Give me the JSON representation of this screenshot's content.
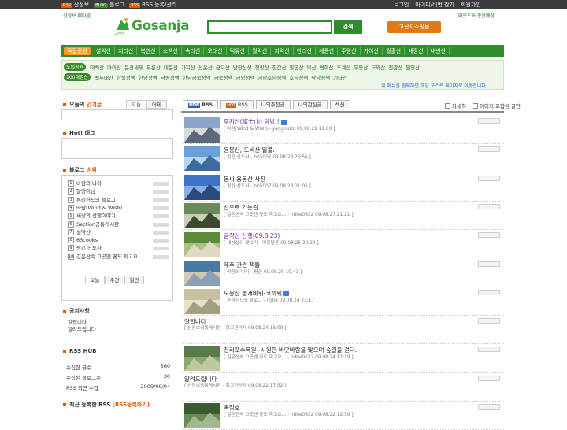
{
  "topbar": {
    "left": [
      {
        "tag": "RSS",
        "label": "산정보"
      },
      {
        "tag": "BLOG",
        "label": "블로그"
      },
      {
        "tag": "RSS",
        "label": "RSS 등록/관리"
      }
    ],
    "right": [
      "로그인",
      "아이디/비번 찾기",
      "회원가입"
    ]
  },
  "subtitle_left": "산정보 메타블",
  "subtitle_right": "마웃도어 종합매장",
  "logo": {
    "text": "Gosanja",
    "korean": "고산자"
  },
  "search": {
    "value": "",
    "button": "검색"
  },
  "shop_button": "고산자쇼핑몰",
  "nav1": {
    "first": "국립공원",
    "items": [
      "설악산",
      "지리산",
      "북한산",
      "소백산",
      "속리산",
      "오대산",
      "덕유산",
      "월악산",
      "치악산",
      "한라산",
      "계룡산",
      "주왕산",
      "가야산",
      "월출산",
      "내장산",
      "내변산"
    ]
  },
  "nav2": {
    "row1_label": "도립공원",
    "row1": [
      "태백산",
      "마이산",
      "문경새재",
      "두륜산",
      "대둔산",
      "가지산",
      "선운산",
      "금오산",
      "남한산성",
      "청량산",
      "칠갑산",
      "팔공산",
      "덕산",
      "연화산",
      "조계산",
      "무등산",
      "모악산",
      "천관산",
      "팔영산"
    ],
    "row2_label": "100대명산",
    "row2": [
      "백두대간",
      "한북정맥",
      "한남정맥",
      "낙동정맥",
      "한남금북정맥",
      "금북정맥",
      "금남정맥",
      "금남호남정맥",
      "호남정맥",
      "낙남정맥",
      "기타산"
    ],
    "note": "위 메뉴를 클릭하면 해당 포스트 페이지로 이동합니다."
  },
  "left": {
    "today": {
      "title_prefix": "오늘의",
      "title_accent": "인기글",
      "tabs": [
        "오늘",
        "어제"
      ]
    },
    "hot": {
      "title": "Hot! 태그"
    },
    "blog": {
      "title_prefix": "블로그",
      "title_accent": "순위",
      "items": [
        "바람의 나라",
        "말방이님",
        "론리헌드의 블로그",
        "바람(Wind & Wish)",
        "세상의 산행이야기",
        "Section공통게시판",
        "설악산",
        "63cooks",
        "링컨 산도사",
        "길은산속 그곳엔 꽃도 피고요..."
      ],
      "tabs": [
        "오늘",
        "주간",
        "월간"
      ]
    },
    "notice": {
      "title": "공지사항",
      "items": [
        "알립니다",
        "알려드립니다"
      ]
    },
    "rsshub": {
      "title": "RSS HUB",
      "rows": [
        {
          "label": "수집한 글수",
          "value": "360"
        },
        {
          "label": "수집된 블로그수",
          "value": "30"
        },
        {
          "label": "RSS 최근 수집",
          "value": "2009/09/04"
        }
      ]
    },
    "recent": {
      "title_prefix": "최근 등록한 RSS",
      "title_accent": "[RSS등록하기]"
    }
  },
  "main": {
    "tabs": [
      {
        "mark": "NEW",
        "label": "RSS"
      },
      {
        "mark": "HOT",
        "label": "RSS"
      },
      {
        "mark": "",
        "label": "나의추천글"
      },
      {
        "mark": "",
        "label": "나의관심글"
      },
      {
        "mark": "",
        "label": "섹션"
      }
    ],
    "options": [
      "자세히",
      "이미지 포함된 글만"
    ],
    "posts": [
      {
        "title": "후지산(富士山) 탐방 !",
        "meta": "[ 바람(Wind & Wish) - yangmoto   09.08.29 11:00 ]",
        "style": "purple",
        "thumb": true,
        "v": true
      },
      {
        "title": "용봉산, 도비산 일몰.",
        "meta": "[ 링컨 산도사 - hh5007   09.08.28 23:56 ]",
        "style": "normal",
        "thumb": true,
        "v": false
      },
      {
        "title": "동씨 용봉산 사진",
        "meta": "[ 링컨 산도사 - hh5007   09.08.28 01:05 ]",
        "style": "normal",
        "thumb": true,
        "v": false
      },
      {
        "title": "산으로 가는길...",
        "meta": "[ 길은산속 그곳엔 꽃도 피고요...  - hdhe0622   09.08.27 21:21 ]",
        "style": "normal",
        "thumb": true,
        "v": false
      },
      {
        "title": "곰작산 산행(09.8.23)",
        "meta": "[ 세상살이 엿보기 - 마르달론   09.08.25 20:29 ]",
        "style": "purple",
        "thumb": true,
        "v": false
      },
      {
        "title": "제주 관련 책들",
        "meta": "[ 바람의 나라 - 평균   09.08.25 10:43 ]",
        "style": "normal",
        "thumb": true,
        "v": false
      },
      {
        "title": "도봉산 물개바위-코끼위",
        "meta": "[ 론리헌드의 블로그 - none   09.08.24 23:17 ]",
        "style": "normal",
        "thumb": true,
        "v": true
      },
      {
        "title": "알립니다",
        "meta": "[ 산정보공통게시판 - 회고관리자   09.08.24 15:09 ]",
        "style": "normal",
        "thumb": false,
        "v": false
      },
      {
        "title": "천리포수목원--시원한 바닷바람을 맞으며 숲길을 걷다.",
        "meta": "[ 길은산속 그곳엔 꽃도 피고요...  - hdhe0622   09.08.24 12:19 ]",
        "style": "normal",
        "thumb": true,
        "v": false
      },
      {
        "title": "알려드립니다",
        "meta": "[ 산정보공통게시판 - 회고관리자   09.08.22 17:52 ]",
        "style": "normal",
        "thumb": false,
        "v": false
      },
      {
        "title": "옥정호",
        "meta": "[ 길은산속 그곳엔 꽃도 피고요...  - hdhe0622   09.08.22 12:50 ]",
        "style": "normal",
        "thumb": true,
        "v": false
      }
    ]
  }
}
